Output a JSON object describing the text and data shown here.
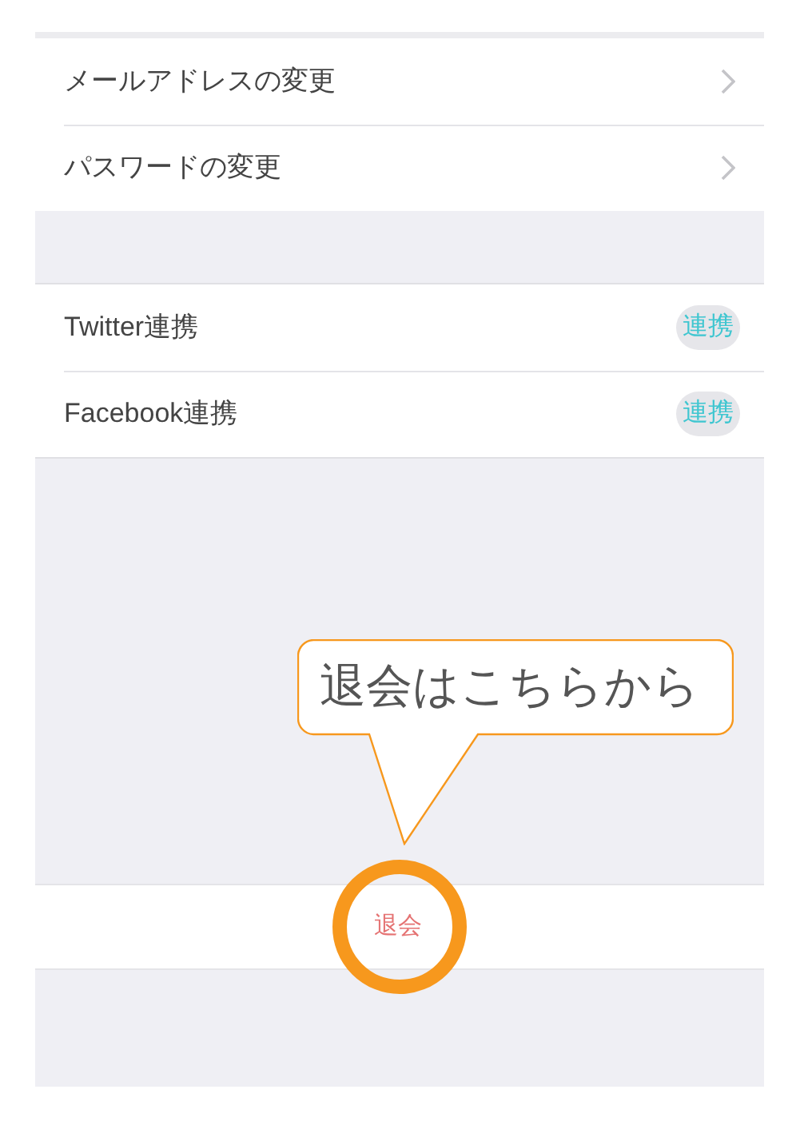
{
  "sections": [
    {
      "rows": [
        {
          "kind": "link",
          "label": "メールアドレスの変更"
        },
        {
          "kind": "link",
          "label": "パスワードの変更"
        }
      ]
    },
    {
      "rows": [
        {
          "kind": "connect",
          "label": "Twitter連携",
          "action": "連携"
        },
        {
          "kind": "connect",
          "label": "Facebook連携",
          "action": "連携"
        }
      ]
    }
  ],
  "withdraw_button": "退会",
  "callout": {
    "text": "退会はこちらから"
  }
}
